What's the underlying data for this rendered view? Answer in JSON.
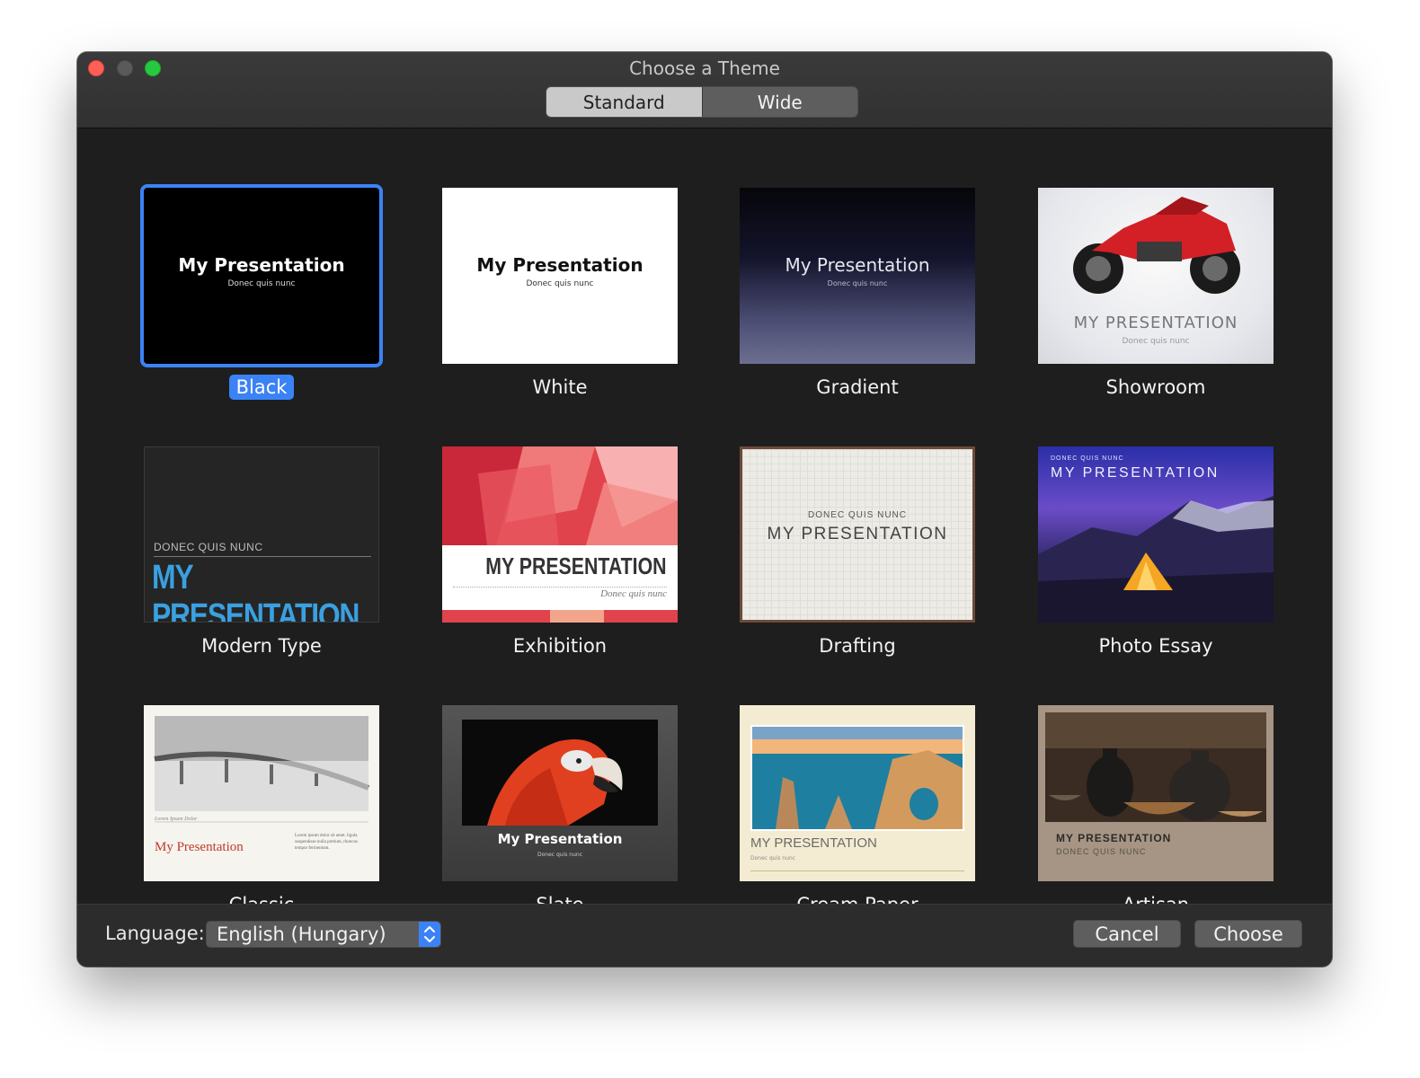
{
  "window": {
    "title": "Choose a Theme"
  },
  "segments": {
    "standard": "Standard",
    "wide": "Wide",
    "selected": "Standard"
  },
  "themes": [
    {
      "name": "Black",
      "selected": true,
      "slide_title": "My Presentation",
      "slide_sub": "Donec quis nunc"
    },
    {
      "name": "White",
      "slide_title": "My Presentation",
      "slide_sub": "Donec quis nunc"
    },
    {
      "name": "Gradient",
      "slide_title": "My Presentation",
      "slide_sub": "Donec quis nunc"
    },
    {
      "name": "Showroom",
      "slide_title": "MY PRESENTATION",
      "slide_sub": "Donec quis nunc"
    },
    {
      "name": "Modern Type",
      "slide_title": "MY PRESENTATION",
      "slide_sub": "DONEC QUIS NUNC"
    },
    {
      "name": "Exhibition",
      "slide_title": "MY PRESENTATION",
      "slide_sub": "Donec quis nunc"
    },
    {
      "name": "Drafting",
      "slide_title": "MY PRESENTATION",
      "slide_sub": "DONEC QUIS NUNC"
    },
    {
      "name": "Photo Essay",
      "slide_title": "MY PRESENTATION",
      "slide_sub": "DONEC QUIS NUNC"
    },
    {
      "name": "Classic",
      "slide_title": "My Presentation",
      "slide_sub": "Lorem Ipsum Dolor",
      "slide_body": "Lorem ipsum dolor sit amet. ligula suspendisse nulla pretium, rhoncus tempor fermentum."
    },
    {
      "name": "Slate",
      "slide_title": "My Presentation",
      "slide_sub": "Donec quis nunc"
    },
    {
      "name": "Cream Paper",
      "slide_title": "MY PRESENTATION",
      "slide_sub": "Donec quis nunc"
    },
    {
      "name": "Artisan",
      "slide_title": "MY PRESENTATION",
      "slide_sub": "DONEC QUIS NUNC"
    }
  ],
  "footer": {
    "language_label": "Language:",
    "language_value": "English (Hungary)",
    "cancel_label": "Cancel",
    "choose_label": "Choose"
  },
  "colors": {
    "accent": "#3b82f6",
    "window_bg": "#1e1e1e"
  }
}
